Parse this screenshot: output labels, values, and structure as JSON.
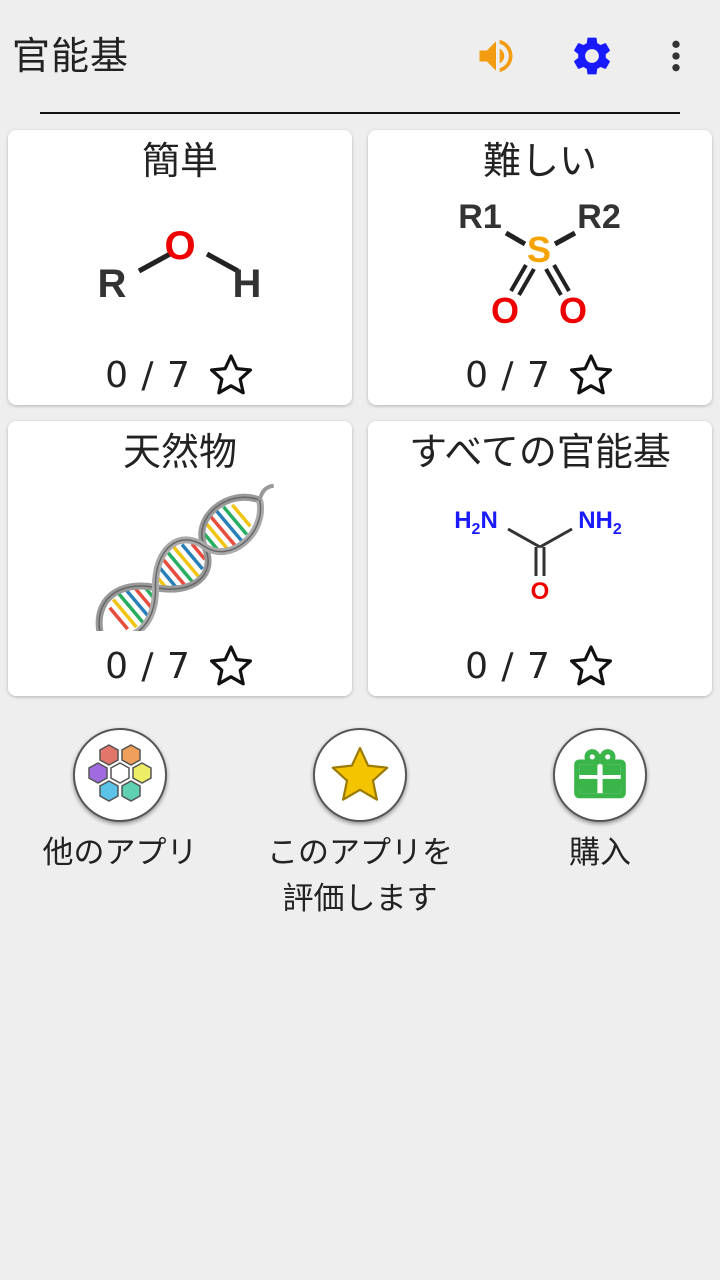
{
  "app": {
    "title": "官能基"
  },
  "colors": {
    "background": "#eeeeee",
    "card": "#ffffff",
    "sound_icon": "#f39c12",
    "settings_icon": "#1a1aff",
    "oxygen": "#ee0000",
    "sulfur": "#f5a300",
    "nitrogen": "#1a1aff",
    "gift": "#3ab54a",
    "star": "#f5c400"
  },
  "toolbar": {
    "icons": [
      "speaker-icon",
      "gear-icon",
      "more-vert-icon"
    ]
  },
  "cards": [
    {
      "title": "簡単",
      "score": "0 / 7",
      "art": {
        "left": "R",
        "center": "O",
        "right": "H"
      }
    },
    {
      "title": "難しい",
      "score": "0 / 7",
      "art": {
        "r1": "R1",
        "r2": "R2",
        "center": "S",
        "o1": "O",
        "o2": "O"
      }
    },
    {
      "title": "天然物",
      "score": "0 / 7",
      "art": {
        "icon": "dna-icon"
      }
    },
    {
      "title": "すべての官能基",
      "score": "0 / 7",
      "art": {
        "left": "H",
        "left_sub": "2",
        "left_n": "N",
        "right_n": "NH",
        "right_sub": "2",
        "bottom": "O"
      }
    }
  ],
  "actions": [
    {
      "label": "他のアプリ",
      "icon": "hexagon-cluster-icon"
    },
    {
      "label": "このアプリを評価します",
      "icon": "star-icon"
    },
    {
      "label": "購入",
      "icon": "gift-icon"
    }
  ]
}
